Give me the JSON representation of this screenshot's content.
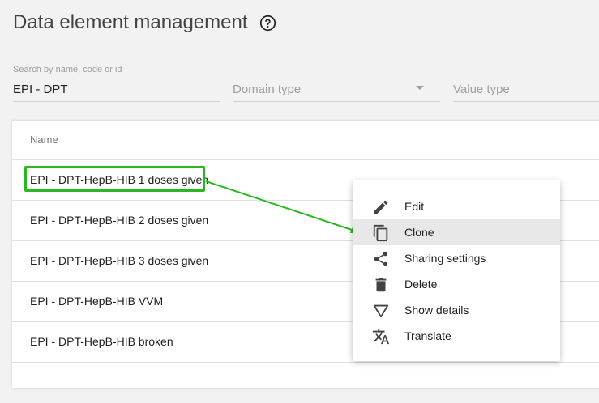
{
  "page": {
    "title": "Data element management",
    "help_icon": "help-circle-icon"
  },
  "filters": {
    "search_label": "Search by name, code or id",
    "search_value": "EPI - DPT",
    "domain_placeholder": "Domain type",
    "value_placeholder": "Value type"
  },
  "table": {
    "header_name": "Name",
    "rows": [
      "EPI - DPT-HepB-HIB 1 doses given",
      "EPI - DPT-HepB-HIB 2 doses given",
      "EPI - DPT-HepB-HIB 3 doses given",
      "EPI - DPT-HepB-HIB VVM",
      "EPI - DPT-HepB-HIB broken"
    ]
  },
  "context_menu": {
    "items": [
      {
        "label": "Edit",
        "icon": "pencil-icon"
      },
      {
        "label": "Clone",
        "icon": "copy-icon"
      },
      {
        "label": "Sharing settings",
        "icon": "share-icon"
      },
      {
        "label": "Delete",
        "icon": "trash-icon"
      },
      {
        "label": "Show details",
        "icon": "triangle-down-icon"
      },
      {
        "label": "Translate",
        "icon": "translate-icon"
      }
    ],
    "active_item": "Clone"
  },
  "colors": {
    "highlight": "#27b91f",
    "background": "#f2f2f2"
  }
}
